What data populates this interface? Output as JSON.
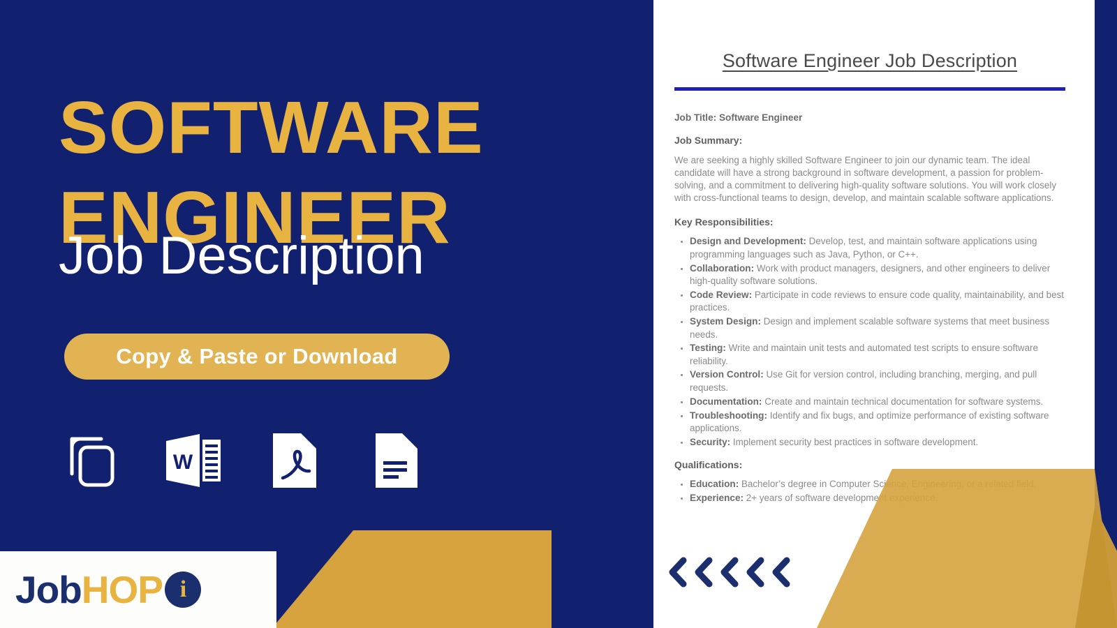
{
  "brand": {
    "navy": "#122070",
    "gold": "#e9b342",
    "gold_shape": "#d6a33f",
    "white": "#ffffff",
    "doc_rule_blue": "#2020b8"
  },
  "left": {
    "headline_line1": "SOFTWARE",
    "headline_line2": "ENGINEER",
    "subhead": "Job Description",
    "cta_label": "Copy & Paste or Download",
    "icons": [
      {
        "name": "copy-icon",
        "label": "Copy"
      },
      {
        "name": "word-document-icon",
        "label": "Word",
        "glyph": "W"
      },
      {
        "name": "pdf-document-icon",
        "label": "PDF"
      },
      {
        "name": "text-document-icon",
        "label": "Document"
      }
    ],
    "logo": {
      "part1": "Job",
      "part2": "HOP",
      "badge": "i"
    }
  },
  "document": {
    "title": "Software Engineer Job Description",
    "job_title_label": "Job Title:",
    "job_title_value": " Software Engineer",
    "summary_heading": "Job Summary:",
    "summary_text": "We are seeking a highly skilled Software Engineer to join our dynamic team. The ideal candidate will have a strong background in software development, a passion for problem-solving, and a commitment to delivering high-quality software solutions. You will work closely with cross-functional teams to design, develop, and maintain scalable software applications.",
    "responsibilities_heading": "Key Responsibilities:",
    "responsibilities": [
      {
        "term": "Design and Development:",
        "desc": " Develop, test, and maintain software applications using programming languages such as Java, Python, or C++."
      },
      {
        "term": "Collaboration:",
        "desc": " Work with product managers, designers, and other engineers to deliver high-quality software solutions."
      },
      {
        "term": "Code Review:",
        "desc": " Participate in code reviews to ensure code quality, maintainability, and best practices."
      },
      {
        "term": "System Design:",
        "desc": " Design and implement scalable software systems that meet business needs."
      },
      {
        "term": "Testing:",
        "desc": " Write and maintain unit tests and automated test scripts to ensure software reliability."
      },
      {
        "term": "Version Control:",
        "desc": " Use Git for version control, including branching, merging, and pull requests."
      },
      {
        "term": "Documentation:",
        "desc": " Create and maintain technical documentation for software systems."
      },
      {
        "term": "Troubleshooting:",
        "desc": " Identify and fix bugs, and optimize performance of existing software applications."
      },
      {
        "term": "Security:",
        "desc": " Implement security best practices in software development."
      }
    ],
    "qualifications_heading": "Qualifications:",
    "qualifications": [
      {
        "term": "Education:",
        "desc": " Bachelor’s degree in Computer Science, Engineering, or a related field."
      },
      {
        "term": "Experience:",
        "desc": " 2+ years of software development experience."
      }
    ],
    "chevron_count": 5
  }
}
